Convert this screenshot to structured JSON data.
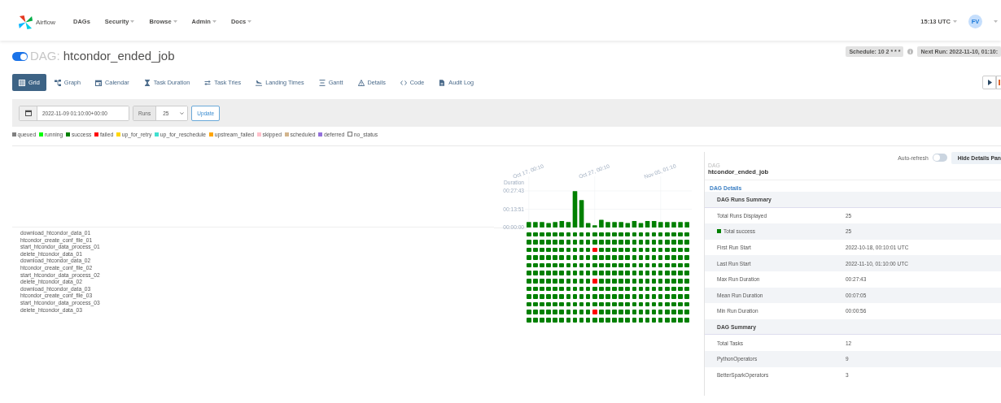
{
  "navbar": {
    "brand": "Airflow",
    "menu": [
      {
        "label": "DAGs",
        "dropdown": false
      },
      {
        "label": "Security",
        "dropdown": true
      },
      {
        "label": "Browse",
        "dropdown": true
      },
      {
        "label": "Admin",
        "dropdown": true
      },
      {
        "label": "Docs",
        "dropdown": true
      }
    ],
    "time": "15:13 UTC",
    "user_initials": "FV"
  },
  "dag_header": {
    "enabled": true,
    "prefix": "DAG:",
    "dag_id": "htcondor_ended_job",
    "schedule": "Schedule: 10 2 * * *",
    "next_run": "Next Run: 2022-11-10, 01:10:"
  },
  "tabs": [
    {
      "label": "Grid",
      "kind": "grid",
      "selected": true
    },
    {
      "label": "Graph",
      "kind": "graph",
      "selected": false
    },
    {
      "label": "Calendar",
      "kind": "calendar",
      "selected": false
    },
    {
      "label": "Task Duration",
      "kind": "hourglass",
      "selected": false
    },
    {
      "label": "Task Tries",
      "kind": "tries",
      "selected": false
    },
    {
      "label": "Landing Times",
      "kind": "landing",
      "selected": false
    },
    {
      "label": "Gantt",
      "kind": "gantt",
      "selected": false
    },
    {
      "label": "Details",
      "kind": "warning",
      "selected": false
    },
    {
      "label": "Code",
      "kind": "code",
      "selected": false
    },
    {
      "label": "Audit Log",
      "kind": "file",
      "selected": false
    }
  ],
  "filters": {
    "base_date": "2022-11-09 01:10:00+00:00",
    "runs_label": "Runs",
    "runs": "25",
    "update": "Update"
  },
  "legend": [
    {
      "label": "queued",
      "color": "#808080"
    },
    {
      "label": "running",
      "color": "#00ff00"
    },
    {
      "label": "success",
      "color": "#008000"
    },
    {
      "label": "failed",
      "color": "#ff0000"
    },
    {
      "label": "up_for_retry",
      "color": "#ffd700"
    },
    {
      "label": "up_for_reschedule",
      "color": "#40e0d0"
    },
    {
      "label": "upstream_failed",
      "color": "#ffa500"
    },
    {
      "label": "skipped",
      "color": "#ffc0cb"
    },
    {
      "label": "scheduled",
      "color": "#d2b48c"
    },
    {
      "label": "deferred",
      "color": "#9370db"
    },
    {
      "label": "no_status",
      "color": "#ffffff"
    }
  ],
  "grid": {
    "chart_data": {
      "type": "bar",
      "ylabel": "Duration",
      "grid": true,
      "categories": [
        "Oct 17, 00:10",
        null,
        null,
        null,
        null,
        null,
        null,
        null,
        null,
        null,
        "Oct 27, 00:10",
        null,
        null,
        null,
        null,
        null,
        null,
        null,
        null,
        null,
        "Nov 05, 01:10",
        null,
        null,
        null,
        null
      ],
      "values": [
        250,
        250,
        250,
        200,
        250,
        300,
        250,
        1650,
        1250,
        200,
        100,
        350,
        250,
        250,
        250,
        200,
        300,
        200,
        300,
        300,
        250,
        250,
        250,
        250,
        250
      ],
      "yticks": [
        {
          "value": 0,
          "label": "00:00:00"
        },
        {
          "value": 831,
          "label": "00:13:51"
        },
        {
          "value": 1663,
          "label": "00:27:43"
        }
      ],
      "ylim": [
        0,
        1663
      ]
    },
    "tasks": [
      {
        "name": "download_htcondor_data_01",
        "cells": [
          {
            "color": "#008000"
          },
          {
            "color": "#008000"
          },
          {
            "color": "#008000"
          },
          {
            "color": "#008000"
          },
          {
            "color": "#008000"
          },
          {
            "color": "#008000"
          },
          {
            "color": "#008000"
          },
          {
            "color": "#008000"
          },
          {
            "color": "#008000"
          },
          {
            "color": "#008000"
          },
          {
            "color": "#008000"
          },
          {
            "color": "#008000"
          },
          {
            "color": "#008000"
          },
          {
            "color": "#008000"
          },
          {
            "color": "#008000"
          },
          {
            "color": "#008000"
          },
          {
            "color": "#008000"
          },
          {
            "color": "#008000"
          },
          {
            "color": "#008000"
          },
          {
            "color": "#008000"
          },
          {
            "color": "#008000"
          },
          {
            "color": "#008000"
          },
          {
            "color": "#008000"
          },
          {
            "color": "#008000"
          },
          {
            "color": "#008000"
          }
        ]
      },
      {
        "name": "htcondor_create_conf_file_01",
        "cells": [
          {
            "color": "#008000"
          },
          {
            "color": "#008000"
          },
          {
            "color": "#008000"
          },
          {
            "color": "#008000"
          },
          {
            "color": "#008000"
          },
          {
            "color": "#008000"
          },
          {
            "color": "#008000"
          },
          {
            "color": "#008000"
          },
          {
            "color": "#008000"
          },
          {
            "color": "#008000"
          },
          {
            "color": "#008000"
          },
          {
            "color": "#008000"
          },
          {
            "color": "#008000"
          },
          {
            "color": "#008000"
          },
          {
            "color": "#008000"
          },
          {
            "color": "#008000"
          },
          {
            "color": "#008000"
          },
          {
            "color": "#008000"
          },
          {
            "color": "#008000"
          },
          {
            "color": "#008000"
          },
          {
            "color": "#008000"
          },
          {
            "color": "#008000"
          },
          {
            "color": "#008000"
          },
          {
            "color": "#008000"
          },
          {
            "color": "#008000"
          }
        ]
      },
      {
        "name": "start_htcondor_data_process_01",
        "cells": [
          {
            "color": "#008000"
          },
          {
            "color": "#008000"
          },
          {
            "color": "#008000"
          },
          {
            "color": "#008000"
          },
          {
            "color": "#008000"
          },
          {
            "color": "#008000"
          },
          {
            "color": "#008000"
          },
          {
            "color": "#008000"
          },
          {
            "color": "#008000"
          },
          {
            "color": "#008000"
          },
          {
            "color": "#ff0000"
          },
          {
            "color": "#008000"
          },
          {
            "color": "#008000"
          },
          {
            "color": "#008000"
          },
          {
            "color": "#008000"
          },
          {
            "color": "#008000"
          },
          {
            "color": "#008000"
          },
          {
            "color": "#008000"
          },
          {
            "color": "#008000"
          },
          {
            "color": "#008000"
          },
          {
            "color": "#008000"
          },
          {
            "color": "#008000"
          },
          {
            "color": "#008000"
          },
          {
            "color": "#008000"
          },
          {
            "color": "#008000"
          }
        ]
      },
      {
        "name": "delete_htcondor_data_01",
        "cells": [
          {
            "color": "#008000"
          },
          {
            "color": "#008000"
          },
          {
            "color": "#008000"
          },
          {
            "color": "#008000"
          },
          {
            "color": "#008000"
          },
          {
            "color": "#008000"
          },
          {
            "color": "#008000"
          },
          {
            "color": "#008000"
          },
          {
            "color": "#008000"
          },
          {
            "color": "#008000"
          },
          {
            "color": "#008000"
          },
          {
            "color": "#008000"
          },
          {
            "color": "#008000"
          },
          {
            "color": "#008000"
          },
          {
            "color": "#008000"
          },
          {
            "color": "#008000"
          },
          {
            "color": "#008000"
          },
          {
            "color": "#008000"
          },
          {
            "color": "#008000"
          },
          {
            "color": "#008000"
          },
          {
            "color": "#008000"
          },
          {
            "color": "#008000"
          },
          {
            "color": "#008000"
          },
          {
            "color": "#008000"
          },
          {
            "color": "#008000"
          }
        ]
      },
      {
        "name": "download_htcondor_data_02",
        "cells": [
          {
            "color": "#008000"
          },
          {
            "color": "#008000"
          },
          {
            "color": "#008000"
          },
          {
            "color": "#008000"
          },
          {
            "color": "#008000"
          },
          {
            "color": "#008000"
          },
          {
            "color": "#008000"
          },
          {
            "color": "#008000"
          },
          {
            "color": "#008000"
          },
          {
            "color": "#008000"
          },
          {
            "color": "#008000"
          },
          {
            "color": "#008000"
          },
          {
            "color": "#008000"
          },
          {
            "color": "#008000"
          },
          {
            "color": "#008000"
          },
          {
            "color": "#008000"
          },
          {
            "color": "#008000"
          },
          {
            "color": "#008000"
          },
          {
            "color": "#008000"
          },
          {
            "color": "#008000"
          },
          {
            "color": "#008000"
          },
          {
            "color": "#008000"
          },
          {
            "color": "#008000"
          },
          {
            "color": "#008000"
          },
          {
            "color": "#008000"
          }
        ]
      },
      {
        "name": "htcondor_create_conf_file_02",
        "cells": [
          {
            "color": "#008000"
          },
          {
            "color": "#008000"
          },
          {
            "color": "#008000"
          },
          {
            "color": "#008000"
          },
          {
            "color": "#008000"
          },
          {
            "color": "#008000"
          },
          {
            "color": "#008000"
          },
          {
            "color": "#008000"
          },
          {
            "color": "#008000"
          },
          {
            "color": "#008000"
          },
          {
            "color": "#008000"
          },
          {
            "color": "#008000"
          },
          {
            "color": "#008000"
          },
          {
            "color": "#008000"
          },
          {
            "color": "#008000"
          },
          {
            "color": "#008000"
          },
          {
            "color": "#008000"
          },
          {
            "color": "#008000"
          },
          {
            "color": "#008000"
          },
          {
            "color": "#008000"
          },
          {
            "color": "#008000"
          },
          {
            "color": "#008000"
          },
          {
            "color": "#008000"
          },
          {
            "color": "#008000"
          },
          {
            "color": "#008000"
          }
        ]
      },
      {
        "name": "start_htcondor_data_process_02",
        "cells": [
          {
            "color": "#008000"
          },
          {
            "color": "#008000"
          },
          {
            "color": "#008000"
          },
          {
            "color": "#008000"
          },
          {
            "color": "#008000"
          },
          {
            "color": "#008000"
          },
          {
            "color": "#008000"
          },
          {
            "color": "#008000"
          },
          {
            "color": "#008000"
          },
          {
            "color": "#008000"
          },
          {
            "color": "#ff0000"
          },
          {
            "color": "#008000"
          },
          {
            "color": "#008000"
          },
          {
            "color": "#008000"
          },
          {
            "color": "#008000"
          },
          {
            "color": "#008000"
          },
          {
            "color": "#008000"
          },
          {
            "color": "#008000"
          },
          {
            "color": "#008000"
          },
          {
            "color": "#008000"
          },
          {
            "color": "#008000"
          },
          {
            "color": "#008000"
          },
          {
            "color": "#008000"
          },
          {
            "color": "#008000"
          },
          {
            "color": "#008000"
          }
        ]
      },
      {
        "name": "delete_htcondor_data_02",
        "cells": [
          {
            "color": "#008000"
          },
          {
            "color": "#008000"
          },
          {
            "color": "#008000"
          },
          {
            "color": "#008000"
          },
          {
            "color": "#008000"
          },
          {
            "color": "#008000"
          },
          {
            "color": "#008000"
          },
          {
            "color": "#008000"
          },
          {
            "color": "#008000"
          },
          {
            "color": "#008000"
          },
          {
            "color": "#008000"
          },
          {
            "color": "#008000"
          },
          {
            "color": "#008000"
          },
          {
            "color": "#008000"
          },
          {
            "color": "#008000"
          },
          {
            "color": "#008000"
          },
          {
            "color": "#008000"
          },
          {
            "color": "#008000"
          },
          {
            "color": "#008000"
          },
          {
            "color": "#008000"
          },
          {
            "color": "#008000"
          },
          {
            "color": "#008000"
          },
          {
            "color": "#008000"
          },
          {
            "color": "#008000"
          },
          {
            "color": "#008000"
          }
        ]
      },
      {
        "name": "download_htcondor_data_03",
        "cells": [
          {
            "color": "#008000"
          },
          {
            "color": "#008000"
          },
          {
            "color": "#008000"
          },
          {
            "color": "#008000"
          },
          {
            "color": "#008000"
          },
          {
            "color": "#008000"
          },
          {
            "color": "#008000"
          },
          {
            "color": "#008000"
          },
          {
            "color": "#008000"
          },
          {
            "color": "#008000"
          },
          {
            "color": "#008000"
          },
          {
            "color": "#008000"
          },
          {
            "color": "#008000"
          },
          {
            "color": "#008000"
          },
          {
            "color": "#008000"
          },
          {
            "color": "#008000"
          },
          {
            "color": "#008000"
          },
          {
            "color": "#008000"
          },
          {
            "color": "#008000"
          },
          {
            "color": "#008000"
          },
          {
            "color": "#008000"
          },
          {
            "color": "#008000"
          },
          {
            "color": "#008000"
          },
          {
            "color": "#008000"
          },
          {
            "color": "#008000"
          }
        ]
      },
      {
        "name": "htcondor_create_conf_file_03",
        "cells": [
          {
            "color": "#008000"
          },
          {
            "color": "#008000"
          },
          {
            "color": "#008000"
          },
          {
            "color": "#008000"
          },
          {
            "color": "#008000"
          },
          {
            "color": "#008000"
          },
          {
            "color": "#008000"
          },
          {
            "color": "#008000"
          },
          {
            "color": "#008000"
          },
          {
            "color": "#008000"
          },
          {
            "color": "#008000"
          },
          {
            "color": "#008000"
          },
          {
            "color": "#008000"
          },
          {
            "color": "#008000"
          },
          {
            "color": "#008000"
          },
          {
            "color": "#008000"
          },
          {
            "color": "#008000"
          },
          {
            "color": "#008000"
          },
          {
            "color": "#008000"
          },
          {
            "color": "#008000"
          },
          {
            "color": "#008000"
          },
          {
            "color": "#008000"
          },
          {
            "color": "#008000"
          },
          {
            "color": "#008000"
          },
          {
            "color": "#008000"
          }
        ]
      },
      {
        "name": "start_htcondor_data_process_03",
        "cells": [
          {
            "color": "#008000"
          },
          {
            "color": "#008000"
          },
          {
            "color": "#008000"
          },
          {
            "color": "#008000"
          },
          {
            "color": "#008000"
          },
          {
            "color": "#008000"
          },
          {
            "color": "#008000"
          },
          {
            "color": "#008000"
          },
          {
            "color": "#008000"
          },
          {
            "color": "#008000"
          },
          {
            "color": "#ff0000"
          },
          {
            "color": "#008000"
          },
          {
            "color": "#008000"
          },
          {
            "color": "#008000"
          },
          {
            "color": "#008000"
          },
          {
            "color": "#008000"
          },
          {
            "color": "#008000"
          },
          {
            "color": "#008000"
          },
          {
            "color": "#008000"
          },
          {
            "color": "#008000"
          },
          {
            "color": "#008000"
          },
          {
            "color": "#008000"
          },
          {
            "color": "#008000"
          },
          {
            "color": "#008000"
          },
          {
            "color": "#008000"
          }
        ]
      },
      {
        "name": "delete_htcondor_data_03",
        "cells": [
          {
            "color": "#008000"
          },
          {
            "color": "#008000"
          },
          {
            "color": "#008000"
          },
          {
            "color": "#008000"
          },
          {
            "color": "#008000"
          },
          {
            "color": "#008000"
          },
          {
            "color": "#008000"
          },
          {
            "color": "#008000"
          },
          {
            "color": "#008000"
          },
          {
            "color": "#008000"
          },
          {
            "color": "#008000"
          },
          {
            "color": "#008000"
          },
          {
            "color": "#008000"
          },
          {
            "color": "#008000"
          },
          {
            "color": "#008000"
          },
          {
            "color": "#008000"
          },
          {
            "color": "#008000"
          },
          {
            "color": "#008000"
          },
          {
            "color": "#008000"
          },
          {
            "color": "#008000"
          },
          {
            "color": "#008000"
          },
          {
            "color": "#008000"
          },
          {
            "color": "#008000"
          },
          {
            "color": "#008000"
          },
          {
            "color": "#008000"
          }
        ]
      }
    ]
  },
  "details": {
    "auto_refresh_label": "Auto-refresh",
    "auto_refresh": false,
    "hide_button": "Hide Details Pan",
    "dag_label": "DAG",
    "dag_id": "htcondor_ended_job",
    "link": "DAG Details",
    "rows": [
      {
        "kind": "header",
        "label": "DAG Runs Summary"
      },
      {
        "kind": "row",
        "label": "Total Runs Displayed",
        "value": "25"
      },
      {
        "kind": "state",
        "label": "Total success",
        "value": "25",
        "color": "#008000"
      },
      {
        "kind": "row",
        "label": "First Run Start",
        "value": "2022-10-18, 00:10:01 UTC"
      },
      {
        "kind": "row",
        "label": "Last Run Start",
        "value": "2022-11-10, 01:10:00 UTC"
      },
      {
        "kind": "row",
        "label": "Max Run Duration",
        "value": "00:27:43"
      },
      {
        "kind": "row",
        "label": "Mean Run Duration",
        "value": "00:07:05"
      },
      {
        "kind": "row",
        "label": "Min Run Duration",
        "value": "00:00:56"
      },
      {
        "kind": "header",
        "label": "DAG Summary"
      },
      {
        "kind": "row",
        "label": "Total Tasks",
        "value": "12"
      },
      {
        "kind": "row",
        "label": "PythonOperators",
        "value": "9"
      },
      {
        "kind": "row",
        "label": "BetterSparkOperators",
        "value": "3"
      }
    ]
  }
}
